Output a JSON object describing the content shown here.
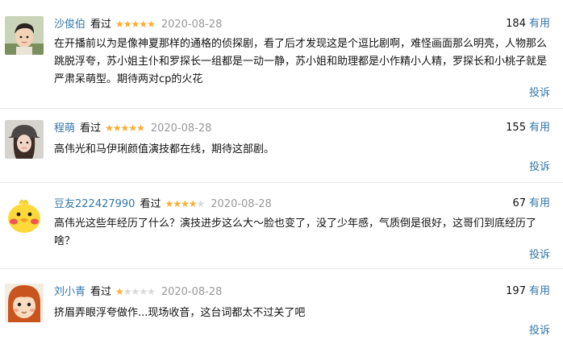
{
  "reviews": [
    {
      "author": "沙俊伯",
      "seen_label": "看过",
      "rating": 5,
      "stars_text": "★★★★★",
      "stars_empty": "",
      "date": "2020-08-28",
      "votes": "184",
      "useful_label": "有用",
      "content": "在开播前以为是像神夏那样的通格的侦探剧，看了后才发现这是个逗比剧啊，难怪画面那么明亮，人物那么跳脱浮夸，苏小姐主仆和罗探长一组都是一动一静，苏小姐和助理都是小作精小人精，罗探长和小桃子就是严肃呆萌型。期待两对cp的火花",
      "report_label": "投诉",
      "avatar_icon": "boy-avatar-icon"
    },
    {
      "author": "程萌",
      "seen_label": "看过",
      "rating": 5,
      "stars_text": "★★★★★",
      "stars_empty": "",
      "date": "2020-08-28",
      "votes": "155",
      "useful_label": "有用",
      "content": "高伟光和马伊琍颜值演技都在线，期待这部剧。",
      "report_label": "投诉",
      "avatar_icon": "girl-cap-avatar-icon"
    },
    {
      "author": "豆友222427990",
      "seen_label": "看过",
      "rating": 4,
      "stars_text": "★★★★",
      "stars_empty": "★",
      "date": "2020-08-28",
      "votes": "67",
      "useful_label": "有用",
      "content": "高伟光这些年经历了什么？演技进步这么大～脸也变了，没了少年感，气质倒是很好，这哥们到底经历了啥？",
      "report_label": "投诉",
      "avatar_icon": "yellow-duck-avatar-icon"
    },
    {
      "author": "刘小青",
      "seen_label": "看过",
      "rating": 1,
      "stars_text": "★",
      "stars_empty": "★★★★",
      "date": "2020-08-28",
      "votes": "197",
      "useful_label": "有用",
      "content": "挤眉弄眼浮夸做作...现场收音，这台词都太不过关了吧",
      "report_label": "投诉",
      "avatar_icon": "cartoon-girl-avatar-icon"
    }
  ]
}
